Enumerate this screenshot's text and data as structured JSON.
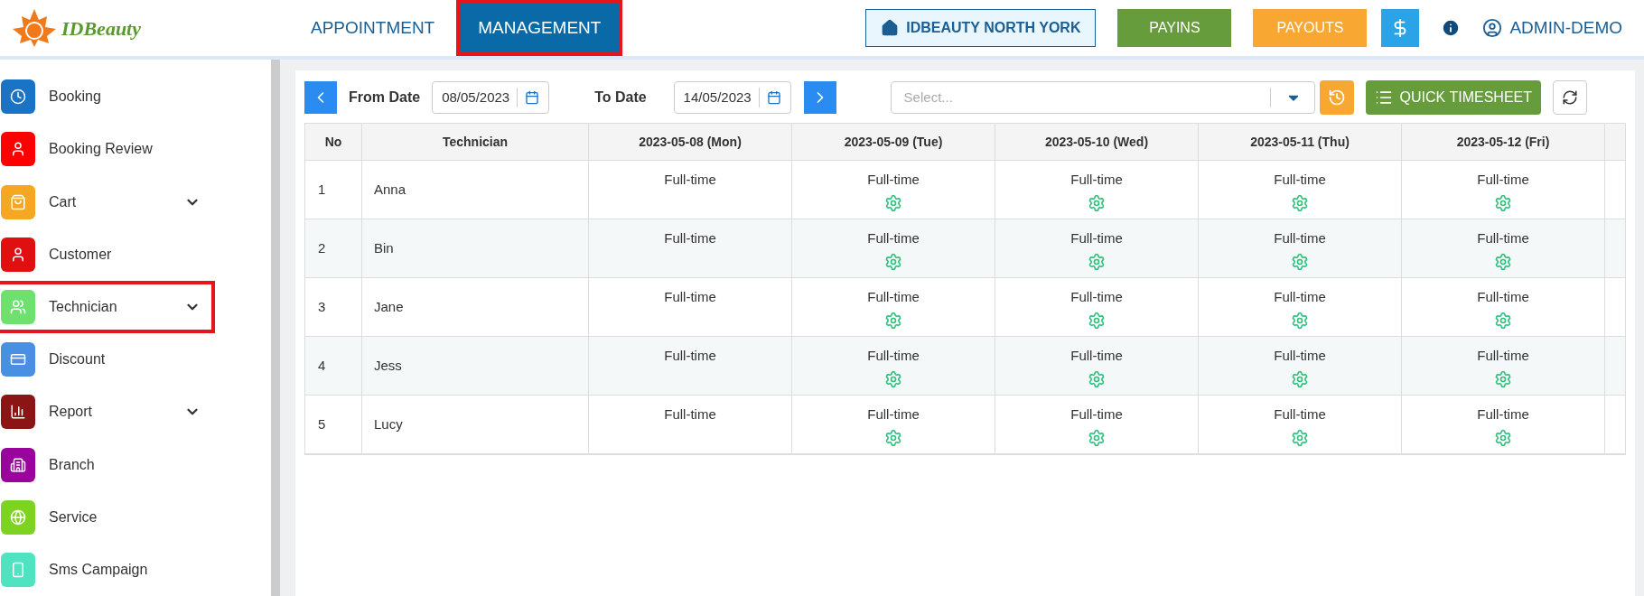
{
  "logo": {
    "text": "IDBeauty"
  },
  "tabs": [
    {
      "label": "APPOINTMENT",
      "selected": false,
      "highlighted": false
    },
    {
      "label": "MANAGEMENT",
      "selected": true,
      "highlighted": true
    }
  ],
  "header": {
    "branch": "IDBEAUTY NORTH YORK",
    "payins": "PAYINS",
    "payouts": "PAYOUTS",
    "user": "ADMIN-DEMO"
  },
  "sidebar": {
    "items": [
      {
        "label": "Booking",
        "color": "#1a73c4",
        "expandable": false,
        "highlighted": false
      },
      {
        "label": "Booking Review",
        "color": "#ff0000",
        "expandable": false,
        "highlighted": false
      },
      {
        "label": "Cart",
        "color": "#f5a623",
        "expandable": true,
        "highlighted": false
      },
      {
        "label": "Customer",
        "color": "#e01010",
        "expandable": false,
        "highlighted": false
      },
      {
        "label": "Technician",
        "color": "#6ee06e",
        "expandable": true,
        "highlighted": true
      },
      {
        "label": "Discount",
        "color": "#4a90e2",
        "expandable": false,
        "highlighted": false
      },
      {
        "label": "Report",
        "color": "#8b1414",
        "expandable": true,
        "highlighted": false
      },
      {
        "label": "Branch",
        "color": "#98049c",
        "expandable": false,
        "highlighted": false
      },
      {
        "label": "Service",
        "color": "#7ed321",
        "expandable": false,
        "highlighted": false
      },
      {
        "label": "Sms Campaign",
        "color": "#50e3c2",
        "expandable": false,
        "highlighted": false
      }
    ]
  },
  "filters": {
    "from_label": "From Date",
    "from_value": "08/05/2023",
    "to_label": "To Date",
    "to_value": "14/05/2023",
    "select_placeholder": "Select...",
    "quick_timesheet": "QUICK TIMESHEET"
  },
  "table": {
    "columns": [
      "No",
      "Technician",
      "2023-05-08 (Mon)",
      "2023-05-09 (Tue)",
      "2023-05-10 (Wed)",
      "2023-05-11 (Thu)",
      "2023-05-12 (Fri)"
    ],
    "rows": [
      {
        "no": "1",
        "name": "Anna",
        "days": [
          {
            "text": "Full-time",
            "settings": false
          },
          {
            "text": "Full-time",
            "settings": true
          },
          {
            "text": "Full-time",
            "settings": true
          },
          {
            "text": "Full-time",
            "settings": true
          },
          {
            "text": "Full-time",
            "settings": true
          }
        ]
      },
      {
        "no": "2",
        "name": "Bin",
        "days": [
          {
            "text": "Full-time",
            "settings": false
          },
          {
            "text": "Full-time",
            "settings": true
          },
          {
            "text": "Full-time",
            "settings": true
          },
          {
            "text": "Full-time",
            "settings": true
          },
          {
            "text": "Full-time",
            "settings": true
          }
        ]
      },
      {
        "no": "3",
        "name": "Jane",
        "days": [
          {
            "text": "Full-time",
            "settings": false
          },
          {
            "text": "Full-time",
            "settings": true
          },
          {
            "text": "Full-time",
            "settings": true
          },
          {
            "text": "Full-time",
            "settings": true
          },
          {
            "text": "Full-time",
            "settings": true
          }
        ]
      },
      {
        "no": "4",
        "name": "Jess",
        "days": [
          {
            "text": "Full-time",
            "settings": false
          },
          {
            "text": "Full-time",
            "settings": true
          },
          {
            "text": "Full-time",
            "settings": true
          },
          {
            "text": "Full-time",
            "settings": true
          },
          {
            "text": "Full-time",
            "settings": true
          }
        ]
      },
      {
        "no": "5",
        "name": "Lucy",
        "days": [
          {
            "text": "Full-time",
            "settings": false
          },
          {
            "text": "Full-time",
            "settings": true
          },
          {
            "text": "Full-time",
            "settings": true
          },
          {
            "text": "Full-time",
            "settings": true
          },
          {
            "text": "Full-time",
            "settings": true
          }
        ]
      }
    ]
  }
}
